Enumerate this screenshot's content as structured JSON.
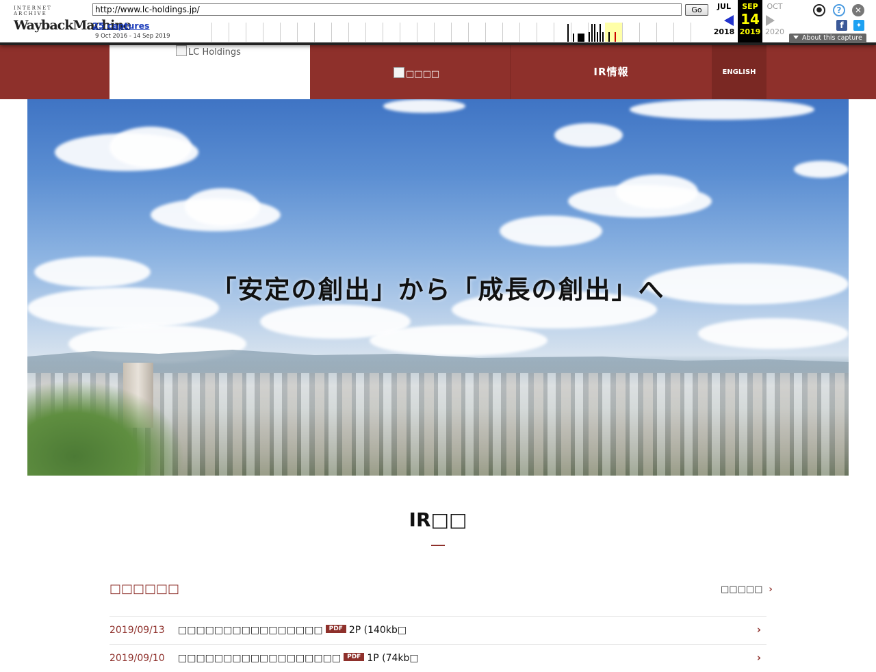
{
  "wayback": {
    "logo_top": "INTERNET ARCHIVE",
    "logo_main_a": "Wayback",
    "logo_main_b": "Machine",
    "url": "http://www.lc-holdings.jp/",
    "go_label": "Go",
    "captures_label": "25 captures",
    "date_range": "9 Oct 2016 - 14 Sep 2019",
    "prev": {
      "month": "JUL",
      "year": "2018"
    },
    "current": {
      "month": "SEP",
      "day": "14",
      "year": "2019"
    },
    "next": {
      "month": "OCT",
      "year": "2020"
    },
    "about_label": "About this capture"
  },
  "nav": {
    "brand_alt": "LC Holdings",
    "item1_alt": "□□□□",
    "ir_label": "IR情報",
    "english_label": "ENGLISH"
  },
  "hero": {
    "headline": "「安定の創出」から「成長の創出」へ"
  },
  "main": {
    "title": "IR□□",
    "news_heading": "□□□□□□",
    "news_more": "□□□□□",
    "news": [
      {
        "date": "2019/09/13",
        "title": "□□□□□□□□□□□□□□□□",
        "badge": "PDF",
        "size": "2P (140kb□"
      },
      {
        "date": "2019/09/10",
        "title": "□□□□□□□□□□□□□□□□□□",
        "badge": "PDF",
        "size": "1P (74kb□"
      }
    ]
  }
}
